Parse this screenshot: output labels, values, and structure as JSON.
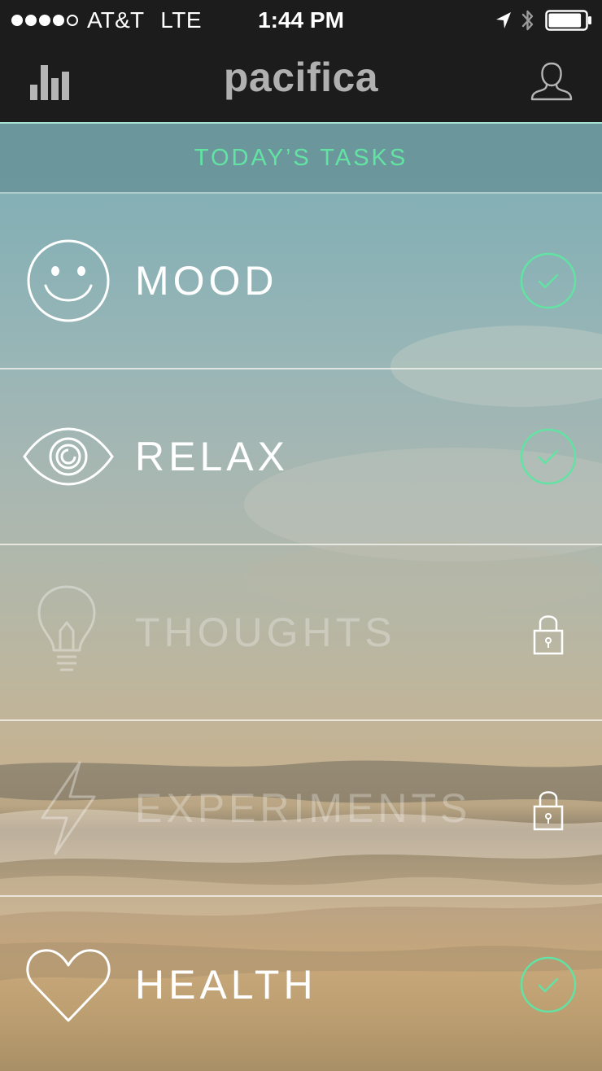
{
  "status_bar": {
    "carrier": "AT&T",
    "network": "LTE",
    "time": "1:44 PM",
    "signal_bars_filled": 4,
    "signal_bars_total": 5,
    "battery_level": 0.9
  },
  "nav": {
    "title": "pacifica",
    "left_icon": "bar-chart-icon",
    "right_icon": "user-profile-icon"
  },
  "tasks_header": "TODAY’S TASKS",
  "tasks": [
    {
      "label": "MOOD",
      "icon": "smiley-face-icon",
      "status": "completed",
      "status_icon": "checkmark-circle-icon"
    },
    {
      "label": "RELAX",
      "icon": "eye-icon",
      "status": "completed",
      "status_icon": "checkmark-circle-icon"
    },
    {
      "label": "THOUGHTS",
      "icon": "lightbulb-icon",
      "status": "locked",
      "status_icon": "padlock-icon"
    },
    {
      "label": "EXPERIMENTS",
      "icon": "lightning-bolt-icon",
      "status": "locked",
      "status_icon": "padlock-icon"
    },
    {
      "label": "HEALTH",
      "icon": "heart-icon",
      "status": "completed",
      "status_icon": "checkmark-circle-icon"
    }
  ],
  "colors": {
    "accent_green": "#62e3a3",
    "nav_background": "#1c1c1c",
    "title_gray": "#b0b0b0"
  }
}
